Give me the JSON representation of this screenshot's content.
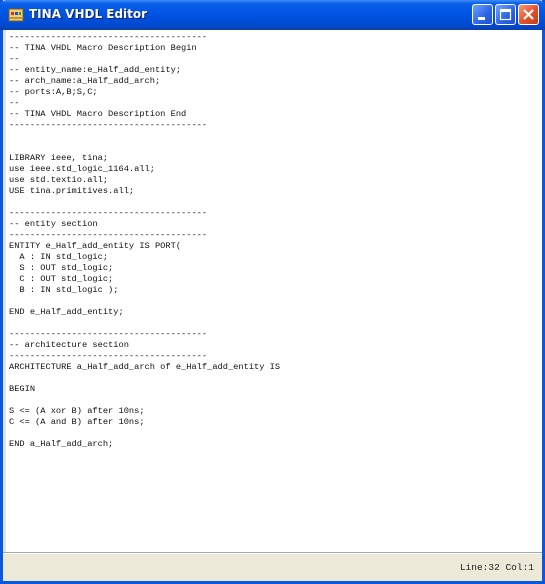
{
  "window": {
    "title": "TINA VHDL Editor",
    "icon": "tina-app-icon",
    "buttons": [
      "minimize",
      "maximize",
      "close"
    ],
    "colors": {
      "titlebar": "#0054e3",
      "close": "#e2512a",
      "frame": "#ece9d8"
    }
  },
  "editor": {
    "lines": [
      "--------------------------------------",
      "-- TINA VHDL Macro Description Begin",
      "--",
      "-- entity_name:e_Half_add_entity;",
      "-- arch_name:a_Half_add_arch;",
      "-- ports:A,B;S,C;",
      "--",
      "-- TINA VHDL Macro Description End",
      "--------------------------------------",
      "",
      "",
      "LIBRARY ieee, tina;",
      "use ieee.std_logic_1164.all;",
      "use std.textio.all;",
      "USE tina.primitives.all;",
      "",
      "--------------------------------------",
      "-- entity section",
      "--------------------------------------",
      "ENTITY e_Half_add_entity IS PORT(",
      "  A : IN std_logic;",
      "  S : OUT std_logic;",
      "  C : OUT std_logic;",
      "  B : IN std_logic );",
      "",
      "END e_Half_add_entity;",
      "",
      "--------------------------------------",
      "-- architecture section",
      "--------------------------------------",
      "ARCHITECTURE a_Half_add_arch of e_Half_add_entity IS",
      "",
      "BEGIN",
      "",
      "S <= (A xor B) after 10ns;",
      "C <= (A and B) after 10ns;",
      "",
      "END a_Half_add_arch;"
    ]
  },
  "status": {
    "line_label": "Line:",
    "line": "32",
    "col_label": "Col:",
    "col": "1"
  }
}
